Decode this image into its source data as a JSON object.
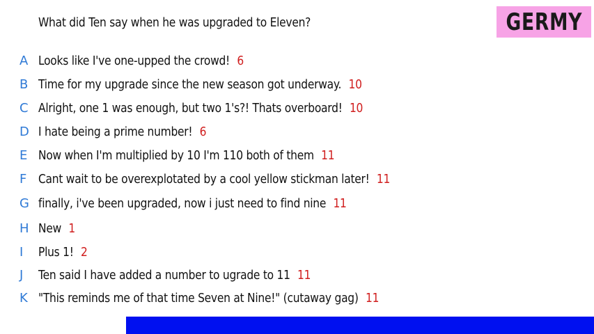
{
  "question": "What did Ten say when he was upgraded to Eleven?",
  "logo_text": "GERMY",
  "answers": [
    {
      "letter": "A",
      "text": "Looks like I've one-upped the crowd!",
      "score": "6"
    },
    {
      "letter": "B",
      "text": "Time for my upgrade since the new season got underway.",
      "score": "10"
    },
    {
      "letter": "C",
      "text": "Alright, one 1 was enough, but two 1's?! Thats overboard!",
      "score": "10"
    },
    {
      "letter": "D",
      "text": "I hate being a prime number!",
      "score": "6"
    },
    {
      "letter": "E",
      "text": "Now when I'm multiplied by 10 I'm 110 both of them",
      "score": "11"
    },
    {
      "letter": "F",
      "text": "Cant wait to be overexplotated by a cool yellow stickman later!",
      "score": "11"
    },
    {
      "letter": "G",
      "text": "finally, i've been upgraded, now i just need to find nine",
      "score": "11"
    },
    {
      "letter": "H",
      "text": "New",
      "score": "1"
    },
    {
      "letter": "I",
      "text": "Plus 1!",
      "score": "2"
    },
    {
      "letter": "J",
      "text": "Ten said I have added a number to ugrade to 11",
      "score": "11"
    },
    {
      "letter": "K",
      "text": "\"This reminds me of that time Seven at Nine!\" (cutaway gag)",
      "score": "11"
    }
  ],
  "colors": {
    "letter": "#2f7ad6",
    "score": "#d01e1e",
    "logo_bg": "#f7a3e6",
    "bar": "#0010f0"
  }
}
